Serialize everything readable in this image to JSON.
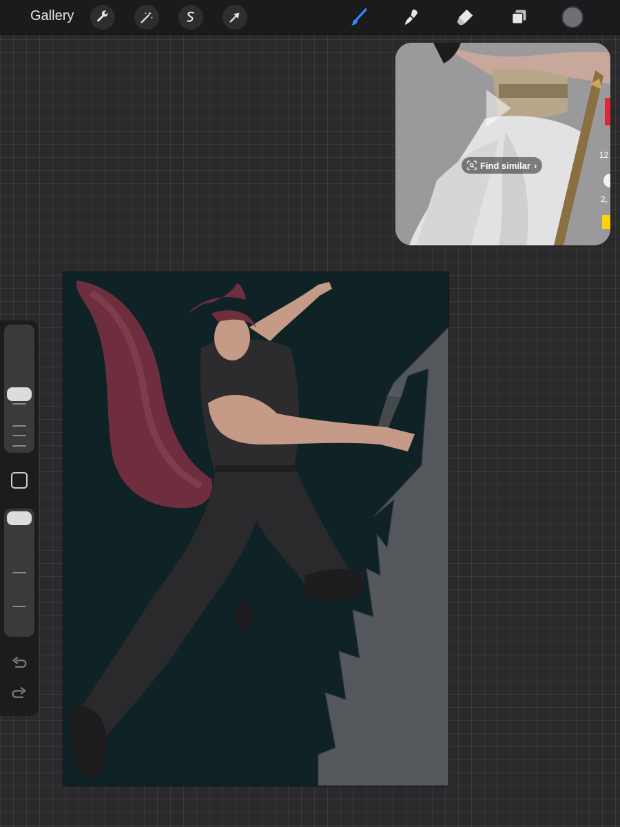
{
  "topbar": {
    "gallery_label": "Gallery",
    "left_tools": [
      {
        "name": "wrench-icon"
      },
      {
        "name": "magic-wand-icon"
      },
      {
        "name": "selection-icon"
      },
      {
        "name": "transform-arrow-icon"
      }
    ],
    "right_tools": [
      {
        "name": "brush-icon",
        "active": true,
        "color": "#2f8bff"
      },
      {
        "name": "smudge-icon"
      },
      {
        "name": "eraser-icon"
      },
      {
        "name": "layers-icon"
      }
    ],
    "current_color": "#6f6f74"
  },
  "reference": {
    "find_similar_label": "Find similar",
    "count_top": "12",
    "count_bottom": "2,"
  },
  "sidebar": {
    "brush_size_level": 0.45,
    "opacity_level": 1.0,
    "icons": [
      "square-modify-icon",
      "undo-icon",
      "redo-icon"
    ]
  },
  "canvas": {
    "background_color": "#0f2226",
    "tail_color": "#6e2e3e",
    "skin_color": "#c59a86",
    "clothing_color": "#2a2a2c",
    "weapon_color": "#54585c"
  }
}
